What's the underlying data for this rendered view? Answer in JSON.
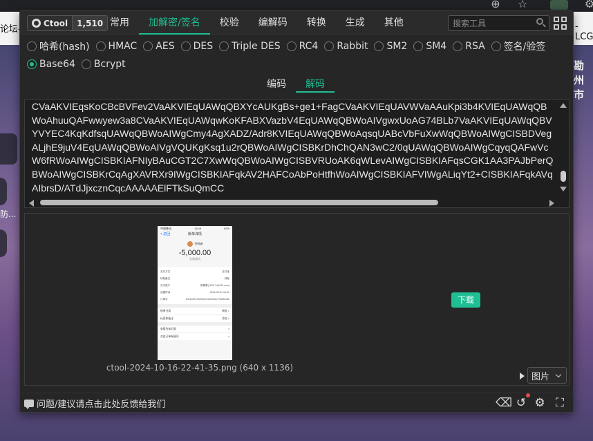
{
  "background": {
    "left_tab_text": "论坛-",
    "right_tab_text": "- LCG",
    "right_page_text": "勘州市",
    "side_text": "防..."
  },
  "header": {
    "brand_name": "Ctool",
    "brand_count": "1,510",
    "nav": [
      {
        "label": "常用"
      },
      {
        "label": "加解密/签名",
        "active": true
      },
      {
        "label": "校验"
      },
      {
        "label": "编解码"
      },
      {
        "label": "转换"
      },
      {
        "label": "生成"
      },
      {
        "label": "其他"
      }
    ],
    "search_placeholder": "搜索工具"
  },
  "algorithms": [
    {
      "label": "哈希(hash)",
      "checked": false
    },
    {
      "label": "HMAC",
      "checked": false
    },
    {
      "label": "AES",
      "checked": false
    },
    {
      "label": "DES",
      "checked": false
    },
    {
      "label": "Triple DES",
      "checked": false
    },
    {
      "label": "RC4",
      "checked": false
    },
    {
      "label": "Rabbit",
      "checked": false
    },
    {
      "label": "SM2",
      "checked": false
    },
    {
      "label": "SM4",
      "checked": false
    },
    {
      "label": "RSA",
      "checked": false
    },
    {
      "label": "签名/验签",
      "checked": false
    },
    {
      "label": "Base64",
      "checked": true
    },
    {
      "label": "Bcrypt",
      "checked": false
    }
  ],
  "subtabs": [
    {
      "label": "编码",
      "active": false
    },
    {
      "label": "解码",
      "active": true
    }
  ],
  "input_lines": [
    "CVaAKVIEqsKoCBcBVFev2VaAKVIEqUAWqQBXYcAUKgBs+ge1+FagCVaAKVIEqUAVWVaAAuKpi3b4KVIEqUAWqQB",
    "WoAhuuQAFwwyew3a8CVaAKVIEqUAWqwKoKFABXVazbV4EqUAWqQBWoAIVgwxUoAG74BLb7VaAKVIEqUAWqQBV",
    "YVYEC4KqKdfsqUAWqQBWoAIWgCmy4AgXADZ/Adr8KVIEqUAWqQBWoAqsqUABcVbFuXwWqQBWoAIWgCISBDVeg",
    "ALjhE9juV4EqUAWqQBWoAIVgVQUKgKsq1u2rQBWoAIWgCISBKrDhChQAN3wC2/0qUAWqQBWoAIWgCqyqQAFwVc",
    "W6fRWoAIWgCISBKIAFNIyBAuCGT2C7XwWqQBWoAIWgCISBVRUoAK6qWLevAIWgCISBKIAFqsCGK1AA3PAJbPerQ",
    "BWoAIWgCISBKrCqAgXAVRXr9IWgCISBKIAFqkAV2HAFCoAbPoHtfhWoAIWgCISBKIAFVIWgALiqYt2+CISBKIAFqkAVq",
    "AIbrsD/ATdJjxcznCqcAAAAAElFTkSuQmCC"
  ],
  "output": {
    "image_caption": "ctool-2024-10-16-22-41-35.png (640 x 1136)",
    "download_label": "下载",
    "type_select_value": "图片",
    "preview": {
      "time": "13:49",
      "carrier": "中国移动",
      "battery": "92%",
      "back": "< 返回",
      "title": "账单详情",
      "merchant": "扫码者",
      "amount": "-5,000.00",
      "status": "交易成功",
      "rows": [
        {
          "k": "支付方式",
          "v": "支付宝"
        },
        {
          "k": "转账备注",
          "v": "转账"
        },
        {
          "k": "对方账户",
          "v": "常喜喜(*429***@163.com)"
        },
        {
          "k": "创建时间",
          "v": "2024-03-21 19:42"
        },
        {
          "k": "订单号",
          "v": "20240321200040011100061778280186"
        }
      ],
      "links": [
        {
          "k": "账单分类",
          "v": "转账 >"
        },
        {
          "k": "标签和备注",
          "v": "添加 >"
        },
        {
          "k": "查看往来记录",
          "v": ">"
        },
        {
          "k": "对此订单有疑问",
          "v": ">"
        }
      ]
    }
  },
  "footer": {
    "feedback_label": "问题/建议请点击此处反馈给我们"
  },
  "colors": {
    "accent": "#1fbf94",
    "panel_bg": "#262626",
    "badge_dot": "#e54b4b"
  }
}
